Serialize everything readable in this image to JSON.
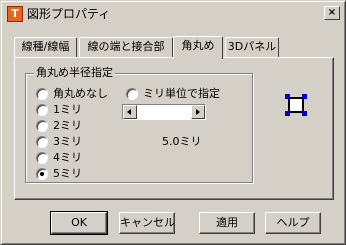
{
  "window": {
    "title": "図形プロパティ",
    "close_glyph": "×",
    "app_icon_glyph": "T"
  },
  "tabs": [
    {
      "label": "線種/線幅",
      "active": false
    },
    {
      "label": "線の端と接合部",
      "active": false
    },
    {
      "label": "角丸め",
      "active": true
    },
    {
      "label": "3Dパネル",
      "active": false
    }
  ],
  "group": {
    "label": "角丸め半径指定",
    "radios": [
      {
        "label": "角丸めなし",
        "checked": false
      },
      {
        "label": "1ミリ",
        "checked": false
      },
      {
        "label": "2ミリ",
        "checked": false
      },
      {
        "label": "3ミリ",
        "checked": false
      },
      {
        "label": "4ミリ",
        "checked": false
      },
      {
        "label": "5ミリ",
        "checked": true
      }
    ],
    "custom_radio": {
      "label": "ミリ単位で指定",
      "checked": false
    },
    "value_text": "5.0ミリ"
  },
  "buttons": {
    "ok": "OK",
    "cancel": "キャンセル",
    "apply": "適用",
    "help": "ヘルプ"
  },
  "colors": {
    "face": "#d4d0c8",
    "handle": "#0000c8",
    "icon": "#e8641b"
  }
}
